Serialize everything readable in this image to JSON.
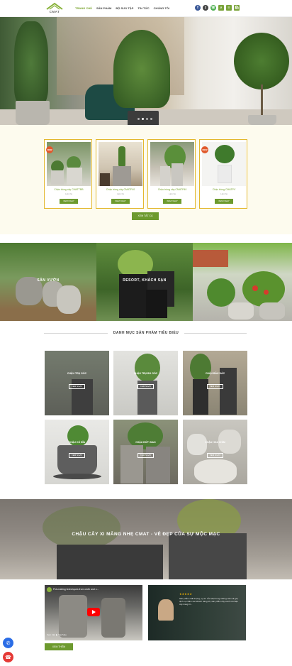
{
  "header": {
    "logo_text": "CMAT",
    "nav": [
      "TRANG CHỦ",
      "SẢN PHẨM",
      "BỘ SƯU TẬP",
      "TIN TỨC",
      "CHÚNG TÔI"
    ],
    "icons": [
      "f",
      "z",
      "☏",
      "⌕",
      "≡",
      "🛍"
    ]
  },
  "products": [
    {
      "name": "Chậu trồng cây CMATTBB",
      "price": "Liên hệ",
      "button": "XEM NGAY",
      "badge": "NEW"
    },
    {
      "name": "Chậu trồng cây CMATF40",
      "price": "Liên hệ",
      "button": "XEM NGAY",
      "badge": ""
    },
    {
      "name": "Chậu trồng cây CMATP40",
      "price": "Liên hệ",
      "button": "XEM NGAY",
      "badge": ""
    },
    {
      "name": "Chậu trồng CMATPV",
      "price": "Liên hệ",
      "button": "XEM NGAY",
      "badge": "NEW"
    }
  ],
  "more_button": "XEM TẤT CẢ",
  "banners": [
    "SÂN VƯỜN",
    "RESORT, KHÁCH SẠN",
    ""
  ],
  "featured_title": "DANH MỤC SẢN PHẨM TIÊU BIỂU",
  "categories": [
    {
      "label": "CHẬU TRỤ GÓC",
      "button": "XEM NGAY"
    },
    {
      "label": "CHẬU TRỤ BO GÓC",
      "button": "XEM NGAY"
    },
    {
      "label": "CHẬU BẦU DÁC",
      "button": "XEM NGAY"
    },
    {
      "label": "CHẬU CÓ ĐĨA",
      "button": "XEM NGAY"
    },
    {
      "label": "CHẬU ĐỨT GIAO",
      "button": "XEM NGAY"
    },
    {
      "label": "CHẬU HOA CHÍM",
      "button": "XEM NGAY"
    }
  ],
  "slogan": "CHẬU CÂY XI MĂNG NHẸ CMAT - VẺ ĐẸP CỦA SỰ MỘC MẠC",
  "video1": {
    "title": "Pot-making techniques from cloth and c...",
    "watch": "Xem trên ▶ YouTube"
  },
  "video2": {
    "quote": "Sản phẩm chất lượng, uy tín của Việt trong những năm về giá, dịch vụ chăm sóc khách hàng tốt, sản phẩm cây xanh và chậu cây trang trí..."
  },
  "view_more": "XEM THÊM"
}
